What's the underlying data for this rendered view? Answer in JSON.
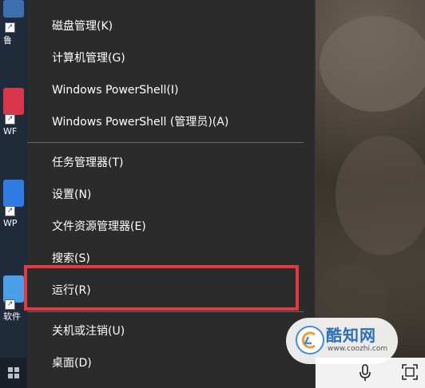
{
  "desktop": {
    "icons": [
      {
        "label": "鲁",
        "color": "#3d6fb0"
      },
      {
        "label": "WF",
        "color": "#d9364a"
      },
      {
        "label": "WP",
        "color": "#2f7be3"
      },
      {
        "label": "软件",
        "color": "#4aa0e8"
      }
    ]
  },
  "context_menu": {
    "items": [
      {
        "label": "磁盘管理(K)"
      },
      {
        "label": "计算机管理(G)"
      },
      {
        "label": "Windows PowerShell(I)"
      },
      {
        "label": "Windows PowerShell (管理员)(A)"
      },
      {
        "label": "任务管理器(T)"
      },
      {
        "label": "设置(N)"
      },
      {
        "label": "文件资源管理器(E)"
      },
      {
        "label": "搜索(S)"
      },
      {
        "label": "运行(R)"
      },
      {
        "label": "关机或注销(U)"
      },
      {
        "label": "桌面(D)"
      }
    ],
    "highlighted_item": "运行(R)",
    "highlight_color": "#e5393f"
  },
  "taskbar": {
    "start_icon": "windows-start-icon",
    "tray_icons": [
      "microphone-icon",
      "screen-snip-icon"
    ]
  },
  "watermark": {
    "name": "酷知网",
    "url": "www.coozhi.com"
  }
}
